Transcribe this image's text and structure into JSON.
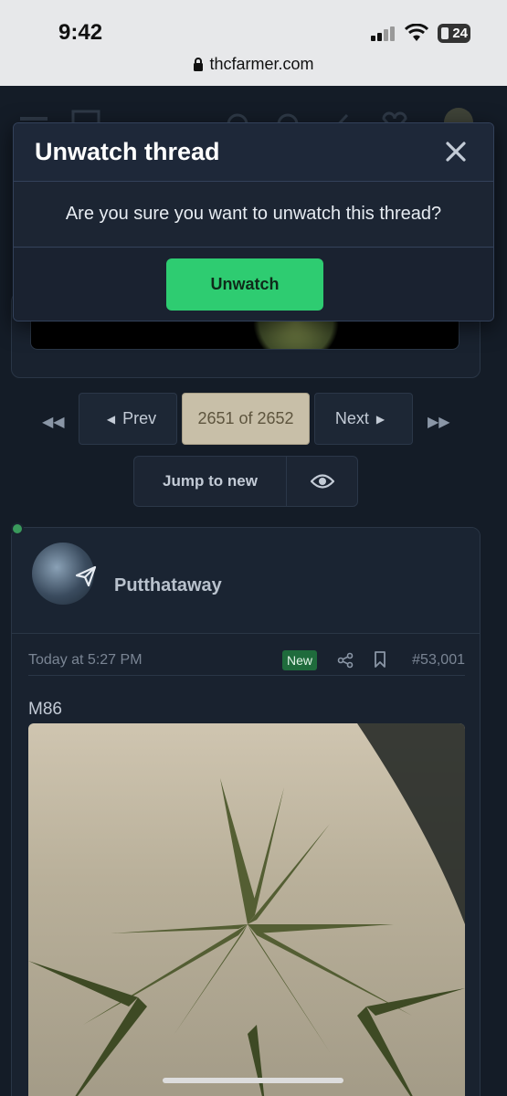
{
  "status_bar": {
    "time": "9:42",
    "battery": "24",
    "url": "thcfarmer.com"
  },
  "modal": {
    "title": "Unwatch thread",
    "message": "Are you sure you want to unwatch this thread?",
    "confirm_label": "Unwatch"
  },
  "pagination": {
    "prev_label": "Prev",
    "current": "2651 of 2652",
    "next_label": "Next"
  },
  "jump": {
    "label": "Jump to new"
  },
  "post": {
    "username": "Putthataway",
    "timestamp": "Today at 5:27 PM",
    "badge": "New",
    "number": "#53,001",
    "text": "M86"
  },
  "colors": {
    "accent_green": "#2ecc71",
    "page_bg": "#17202c",
    "current_page_bg": "#c8bfa8"
  },
  "icons": [
    "lock-icon",
    "signal-icon",
    "wifi-icon",
    "close-icon",
    "first-page-icon",
    "last-page-icon",
    "eye-icon",
    "send-icon",
    "share-icon",
    "bookmark-icon"
  ]
}
